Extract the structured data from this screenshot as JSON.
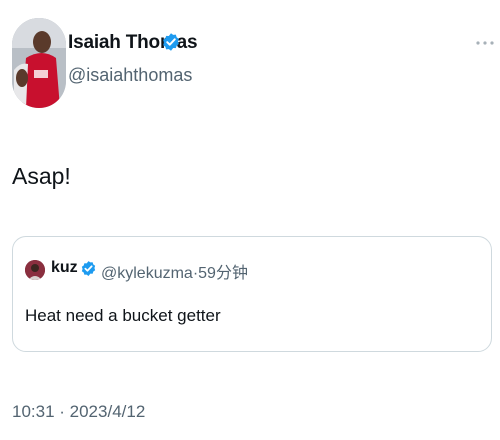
{
  "tweet": {
    "author": {
      "name": "Isaiah Thomas",
      "handle": "@isaiahthomas",
      "verified_color": "#1d9bf0"
    },
    "text": "Asap!",
    "quoted": {
      "name": "kuz",
      "meta": "@kylekuzma·59分钟",
      "text": "Heat need a bucket getter"
    },
    "timestamp": "10:31 · 2023/4/12"
  },
  "icons": {
    "verified": "verified-badge-icon",
    "more": "more-options-icon"
  },
  "colors": {
    "text_primary": "#0f1419",
    "text_secondary": "#536471",
    "border": "#cfd9de",
    "verified": "#1d9bf0"
  }
}
